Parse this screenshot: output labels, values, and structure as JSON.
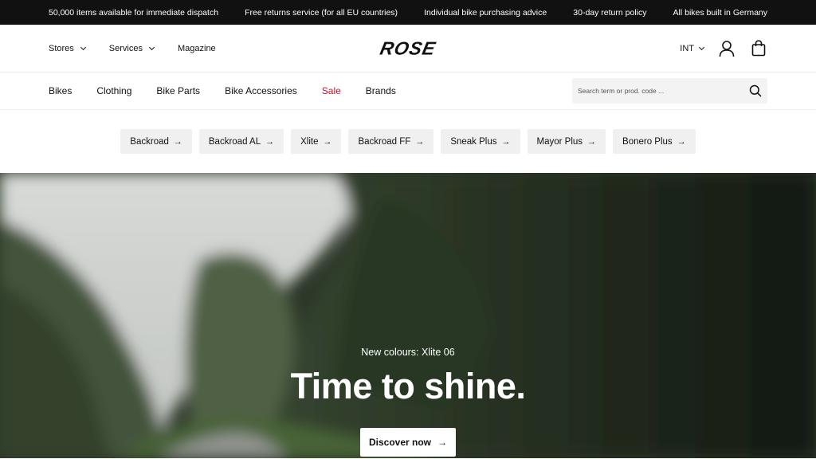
{
  "topbar": {
    "messages": [
      "50,000 items available for immediate dispatch",
      "Free returns service (for all EU countries)",
      "Individual bike purchasing advice",
      "30-day return policy",
      "All bikes built in Germany"
    ]
  },
  "header": {
    "left": [
      {
        "label": "Stores",
        "icon": "chevron-down-icon"
      },
      {
        "label": "Services",
        "icon": "chevron-down-icon"
      },
      {
        "label": "Magazine"
      }
    ],
    "logo": "ROSE",
    "language": "INT",
    "icons": [
      "user-icon",
      "shopping-bag-icon"
    ]
  },
  "nav": {
    "links": [
      "Bikes",
      "Clothing",
      "Bike Parts",
      "Bike Accessories",
      "Sale",
      "Brands"
    ],
    "sale_color": "#c8102e",
    "search_placeholder": "Search term or prod. code ...",
    "search_icon": "search-icon"
  },
  "quick_links": [
    {
      "label": "Backroad",
      "arrow": "→"
    },
    {
      "label": "Backroad AL",
      "arrow": "→"
    },
    {
      "label": "Xlite",
      "arrow": "→"
    },
    {
      "label": "Backroad FF",
      "arrow": "→"
    },
    {
      "label": "Sneak Plus",
      "arrow": "→"
    },
    {
      "label": "Mayor Plus",
      "arrow": "→"
    },
    {
      "label": "Bonero Plus",
      "arrow": "→"
    }
  ],
  "hero": {
    "eyebrow": "New colours: Xlite 06",
    "title": "Time to shine.",
    "cta_label": "Discover now",
    "cta_arrow": "→"
  }
}
